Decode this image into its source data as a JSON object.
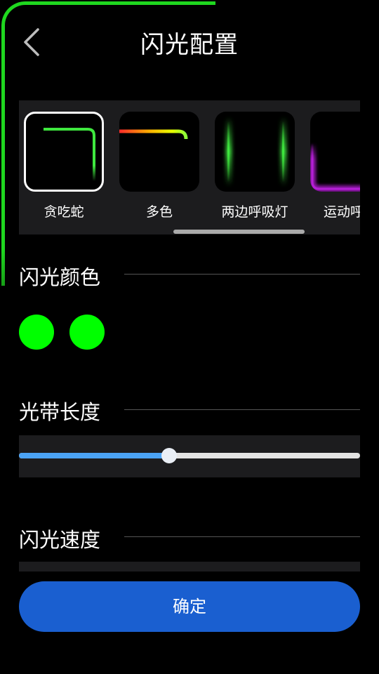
{
  "header": {
    "title": "闪光配置",
    "back_icon": "chevron-left-icon"
  },
  "effects": {
    "selected_index": 0,
    "items": [
      {
        "label": "贪吃蛇",
        "icon": "snake-effect-preview"
      },
      {
        "label": "多色",
        "icon": "multicolor-effect-preview"
      },
      {
        "label": "两边呼吸灯",
        "icon": "side-breathing-effect-preview"
      },
      {
        "label": "运动呼吸",
        "icon": "motion-breathing-effect-preview"
      }
    ]
  },
  "flash_color": {
    "title": "闪光颜色",
    "colors": [
      "#00ff00",
      "#00ff00"
    ]
  },
  "band_length": {
    "title": "光带长度",
    "value_fraction": 0.44
  },
  "flash_speed": {
    "title": "闪光速度"
  },
  "confirm": {
    "label": "确定"
  },
  "theme": {
    "accent": "#1a5fd0",
    "slider_fill": "#4ba3f5",
    "glow_green": "#1fd81f"
  }
}
